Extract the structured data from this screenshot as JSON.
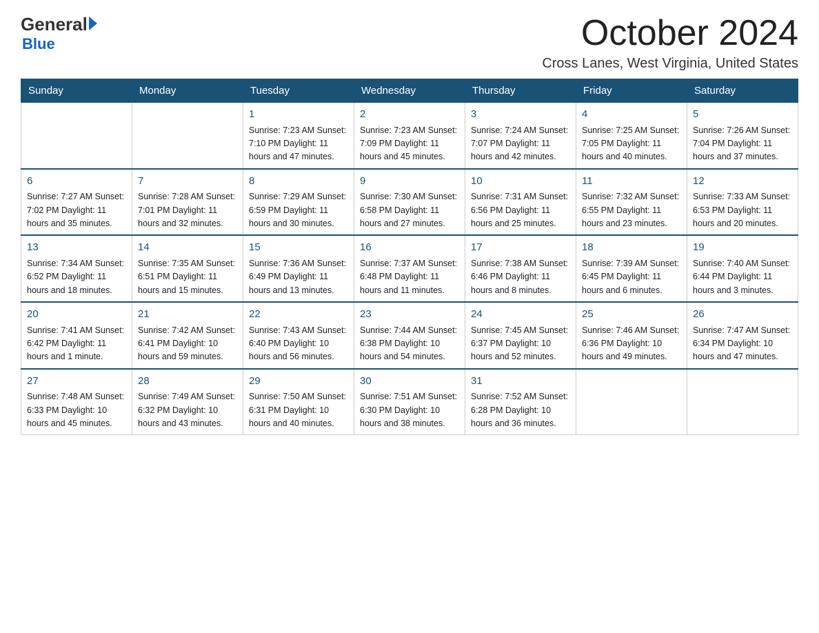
{
  "logo": {
    "general": "General",
    "arrow": "",
    "blue": "Blue"
  },
  "title": "October 2024",
  "location": "Cross Lanes, West Virginia, United States",
  "days_of_week": [
    "Sunday",
    "Monday",
    "Tuesday",
    "Wednesday",
    "Thursday",
    "Friday",
    "Saturday"
  ],
  "weeks": [
    [
      {
        "day": "",
        "info": ""
      },
      {
        "day": "",
        "info": ""
      },
      {
        "day": "1",
        "info": "Sunrise: 7:23 AM\nSunset: 7:10 PM\nDaylight: 11 hours\nand 47 minutes."
      },
      {
        "day": "2",
        "info": "Sunrise: 7:23 AM\nSunset: 7:09 PM\nDaylight: 11 hours\nand 45 minutes."
      },
      {
        "day": "3",
        "info": "Sunrise: 7:24 AM\nSunset: 7:07 PM\nDaylight: 11 hours\nand 42 minutes."
      },
      {
        "day": "4",
        "info": "Sunrise: 7:25 AM\nSunset: 7:05 PM\nDaylight: 11 hours\nand 40 minutes."
      },
      {
        "day": "5",
        "info": "Sunrise: 7:26 AM\nSunset: 7:04 PM\nDaylight: 11 hours\nand 37 minutes."
      }
    ],
    [
      {
        "day": "6",
        "info": "Sunrise: 7:27 AM\nSunset: 7:02 PM\nDaylight: 11 hours\nand 35 minutes."
      },
      {
        "day": "7",
        "info": "Sunrise: 7:28 AM\nSunset: 7:01 PM\nDaylight: 11 hours\nand 32 minutes."
      },
      {
        "day": "8",
        "info": "Sunrise: 7:29 AM\nSunset: 6:59 PM\nDaylight: 11 hours\nand 30 minutes."
      },
      {
        "day": "9",
        "info": "Sunrise: 7:30 AM\nSunset: 6:58 PM\nDaylight: 11 hours\nand 27 minutes."
      },
      {
        "day": "10",
        "info": "Sunrise: 7:31 AM\nSunset: 6:56 PM\nDaylight: 11 hours\nand 25 minutes."
      },
      {
        "day": "11",
        "info": "Sunrise: 7:32 AM\nSunset: 6:55 PM\nDaylight: 11 hours\nand 23 minutes."
      },
      {
        "day": "12",
        "info": "Sunrise: 7:33 AM\nSunset: 6:53 PM\nDaylight: 11 hours\nand 20 minutes."
      }
    ],
    [
      {
        "day": "13",
        "info": "Sunrise: 7:34 AM\nSunset: 6:52 PM\nDaylight: 11 hours\nand 18 minutes."
      },
      {
        "day": "14",
        "info": "Sunrise: 7:35 AM\nSunset: 6:51 PM\nDaylight: 11 hours\nand 15 minutes."
      },
      {
        "day": "15",
        "info": "Sunrise: 7:36 AM\nSunset: 6:49 PM\nDaylight: 11 hours\nand 13 minutes."
      },
      {
        "day": "16",
        "info": "Sunrise: 7:37 AM\nSunset: 6:48 PM\nDaylight: 11 hours\nand 11 minutes."
      },
      {
        "day": "17",
        "info": "Sunrise: 7:38 AM\nSunset: 6:46 PM\nDaylight: 11 hours\nand 8 minutes."
      },
      {
        "day": "18",
        "info": "Sunrise: 7:39 AM\nSunset: 6:45 PM\nDaylight: 11 hours\nand 6 minutes."
      },
      {
        "day": "19",
        "info": "Sunrise: 7:40 AM\nSunset: 6:44 PM\nDaylight: 11 hours\nand 3 minutes."
      }
    ],
    [
      {
        "day": "20",
        "info": "Sunrise: 7:41 AM\nSunset: 6:42 PM\nDaylight: 11 hours\nand 1 minute."
      },
      {
        "day": "21",
        "info": "Sunrise: 7:42 AM\nSunset: 6:41 PM\nDaylight: 10 hours\nand 59 minutes."
      },
      {
        "day": "22",
        "info": "Sunrise: 7:43 AM\nSunset: 6:40 PM\nDaylight: 10 hours\nand 56 minutes."
      },
      {
        "day": "23",
        "info": "Sunrise: 7:44 AM\nSunset: 6:38 PM\nDaylight: 10 hours\nand 54 minutes."
      },
      {
        "day": "24",
        "info": "Sunrise: 7:45 AM\nSunset: 6:37 PM\nDaylight: 10 hours\nand 52 minutes."
      },
      {
        "day": "25",
        "info": "Sunrise: 7:46 AM\nSunset: 6:36 PM\nDaylight: 10 hours\nand 49 minutes."
      },
      {
        "day": "26",
        "info": "Sunrise: 7:47 AM\nSunset: 6:34 PM\nDaylight: 10 hours\nand 47 minutes."
      }
    ],
    [
      {
        "day": "27",
        "info": "Sunrise: 7:48 AM\nSunset: 6:33 PM\nDaylight: 10 hours\nand 45 minutes."
      },
      {
        "day": "28",
        "info": "Sunrise: 7:49 AM\nSunset: 6:32 PM\nDaylight: 10 hours\nand 43 minutes."
      },
      {
        "day": "29",
        "info": "Sunrise: 7:50 AM\nSunset: 6:31 PM\nDaylight: 10 hours\nand 40 minutes."
      },
      {
        "day": "30",
        "info": "Sunrise: 7:51 AM\nSunset: 6:30 PM\nDaylight: 10 hours\nand 38 minutes."
      },
      {
        "day": "31",
        "info": "Sunrise: 7:52 AM\nSunset: 6:28 PM\nDaylight: 10 hours\nand 36 minutes."
      },
      {
        "day": "",
        "info": ""
      },
      {
        "day": "",
        "info": ""
      }
    ]
  ]
}
